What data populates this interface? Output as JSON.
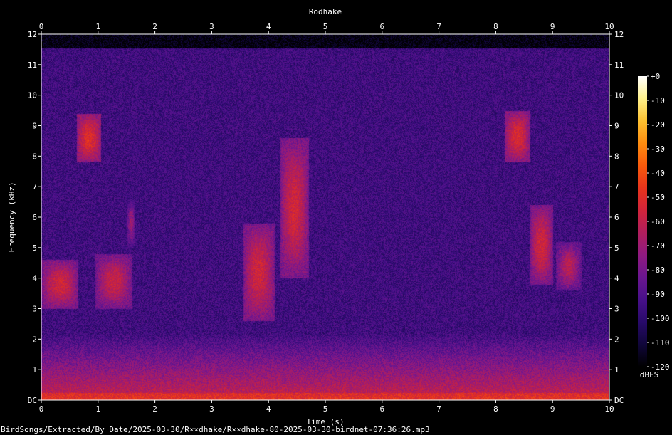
{
  "chart_data": {
    "type": "heatmap",
    "title": "Rodhake",
    "xlabel": "Time (s)",
    "ylabel": "Frequency (kHz)",
    "xlim": [
      0,
      10
    ],
    "ylim": [
      0,
      12
    ],
    "x_ticks": [
      "0",
      "1",
      "2",
      "3",
      "4",
      "5",
      "6",
      "7",
      "8",
      "9",
      "10"
    ],
    "y_ticks": [
      "DC",
      "1",
      "2",
      "3",
      "4",
      "5",
      "6",
      "7",
      "8",
      "9",
      "10",
      "11",
      "12"
    ],
    "colorbar": {
      "unit": "dBFS",
      "range": [
        -120,
        0
      ],
      "ticks": [
        "+0",
        "-10",
        "-20",
        "-30",
        "-40",
        "-50",
        "-60",
        "-70",
        "-80",
        "-90",
        "-100",
        "-110",
        "-120"
      ],
      "colors": [
        "#000000",
        "#10063a",
        "#280a6a",
        "#48108a",
        "#6a1690",
        "#901a80",
        "#b01e5c",
        "#d0243a",
        "#e8341c",
        "#f85a0c",
        "#fc8c10",
        "#fcc030",
        "#fef08a",
        "#ffffff"
      ]
    },
    "background_db": -95,
    "vocalization_bands": [
      {
        "t0": 0.0,
        "t1": 0.65,
        "f0": 3.0,
        "f1": 4.6,
        "db": -55
      },
      {
        "t0": 0.62,
        "t1": 1.05,
        "f0": 7.8,
        "f1": 9.4,
        "db": -50
      },
      {
        "t0": 0.95,
        "t1": 1.6,
        "f0": 3.0,
        "f1": 4.8,
        "db": -58
      },
      {
        "t0": 1.5,
        "t1": 1.65,
        "f0": 5.0,
        "f1": 6.6,
        "db": -70
      },
      {
        "t0": 3.55,
        "t1": 4.1,
        "f0": 2.6,
        "f1": 5.8,
        "db": -55
      },
      {
        "t0": 4.2,
        "t1": 4.7,
        "f0": 4.0,
        "f1": 8.6,
        "db": -55
      },
      {
        "t0": 8.15,
        "t1": 8.6,
        "f0": 7.8,
        "f1": 9.5,
        "db": -52
      },
      {
        "t0": 8.6,
        "t1": 9.0,
        "f0": 3.8,
        "f1": 6.4,
        "db": -55
      },
      {
        "t0": 9.05,
        "t1": 9.5,
        "f0": 3.6,
        "f1": 5.2,
        "db": -62
      }
    ]
  },
  "footer": {
    "path": "BirdSongs/Extracted/By_Date/2025-03-30/R××dhake/R××dhake-80-2025-03-30-birdnet-07:36:26.mp3"
  }
}
